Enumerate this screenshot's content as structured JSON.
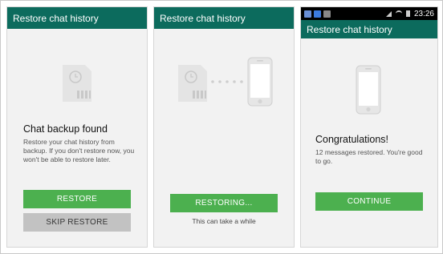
{
  "screens": [
    {
      "app_title": "Restore chat history",
      "icon": "sd-card-with-clock-icon",
      "heading": "Chat backup found",
      "description": "Restore your chat history from backup. If you don't restore now, you won't be able to restore later.",
      "primary_button": "RESTORE",
      "secondary_button": "SKIP RESTORE"
    },
    {
      "app_title": "Restore chat history",
      "icons": [
        "sd-card-with-clock-icon",
        "transfer-dots-icon",
        "phone-icon"
      ],
      "progress_button": "RESTORING...",
      "note": "This can take a while"
    },
    {
      "status_bar": {
        "time": "23:26"
      },
      "app_title": "Restore chat history",
      "icon": "phone-icon",
      "heading": "Congratulations!",
      "description": "12 messages restored. You're good to go.",
      "primary_button": "CONTINUE"
    }
  ],
  "colors": {
    "app_bar": "#0c6b5d",
    "button_primary": "#4cb04f",
    "button_secondary": "#c2c2c2",
    "screen_bg": "#f2f2f2"
  }
}
